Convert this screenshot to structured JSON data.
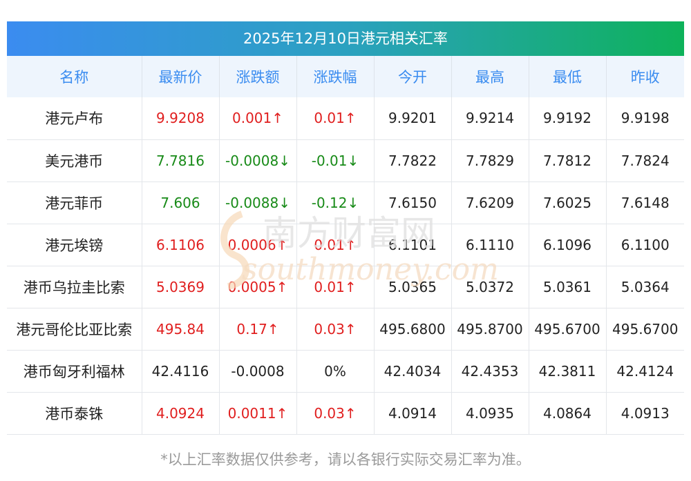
{
  "title": "2025年12月10日港元相关汇率",
  "columns": [
    "名称",
    "最新价",
    "涨跌额",
    "涨跌幅",
    "今开",
    "最高",
    "最低",
    "昨收"
  ],
  "rows": [
    {
      "name": "港元卢布",
      "latest": "9.9208",
      "change": "0.001↑",
      "pct": "0.01↑",
      "open": "9.9201",
      "high": "9.9214",
      "low": "9.9192",
      "prev": "9.9198",
      "trend": "up"
    },
    {
      "name": "美元港币",
      "latest": "7.7816",
      "change": "-0.0008↓",
      "pct": "-0.01↓",
      "open": "7.7822",
      "high": "7.7829",
      "low": "7.7812",
      "prev": "7.7824",
      "trend": "down"
    },
    {
      "name": "港元菲币",
      "latest": "7.606",
      "change": "-0.0088↓",
      "pct": "-0.12↓",
      "open": "7.6150",
      "high": "7.6209",
      "low": "7.6025",
      "prev": "7.6148",
      "trend": "down"
    },
    {
      "name": "港元埃镑",
      "latest": "6.1106",
      "change": "0.0006↑",
      "pct": "0.01↑",
      "open": "6.1101",
      "high": "6.1110",
      "low": "6.1096",
      "prev": "6.1100",
      "trend": "up"
    },
    {
      "name": "港币乌拉圭比索",
      "latest": "5.0369",
      "change": "0.0005↑",
      "pct": "0.01↑",
      "open": "5.0365",
      "high": "5.0372",
      "low": "5.0361",
      "prev": "5.0364",
      "trend": "up"
    },
    {
      "name": "港元哥伦比亚比索",
      "latest": "495.84",
      "change": "0.17↑",
      "pct": "0.03↑",
      "open": "495.6800",
      "high": "495.8700",
      "low": "495.6700",
      "prev": "495.6700",
      "trend": "up"
    },
    {
      "name": "港币匈牙利福林",
      "latest": "42.4116",
      "change": "-0.0008",
      "pct": "0%",
      "open": "42.4034",
      "high": "42.4353",
      "low": "42.3811",
      "prev": "42.4124",
      "trend": "flat"
    },
    {
      "name": "港币泰铢",
      "latest": "4.0924",
      "change": "0.0011↑",
      "pct": "0.03↑",
      "open": "4.0914",
      "high": "4.0935",
      "low": "4.0864",
      "prev": "4.0913",
      "trend": "up"
    }
  ],
  "watermark": {
    "cn": "南方财富网",
    "en": "southmoney.com"
  },
  "footnote": "*以上汇率数据仅供参考，请以各银行实际交易汇率为准。",
  "colors": {
    "up": "#e01e1e",
    "down": "#178a17",
    "header_text": "#3a8cf0",
    "title_start": "#3b8cf0",
    "title_end": "#0eb25a"
  }
}
